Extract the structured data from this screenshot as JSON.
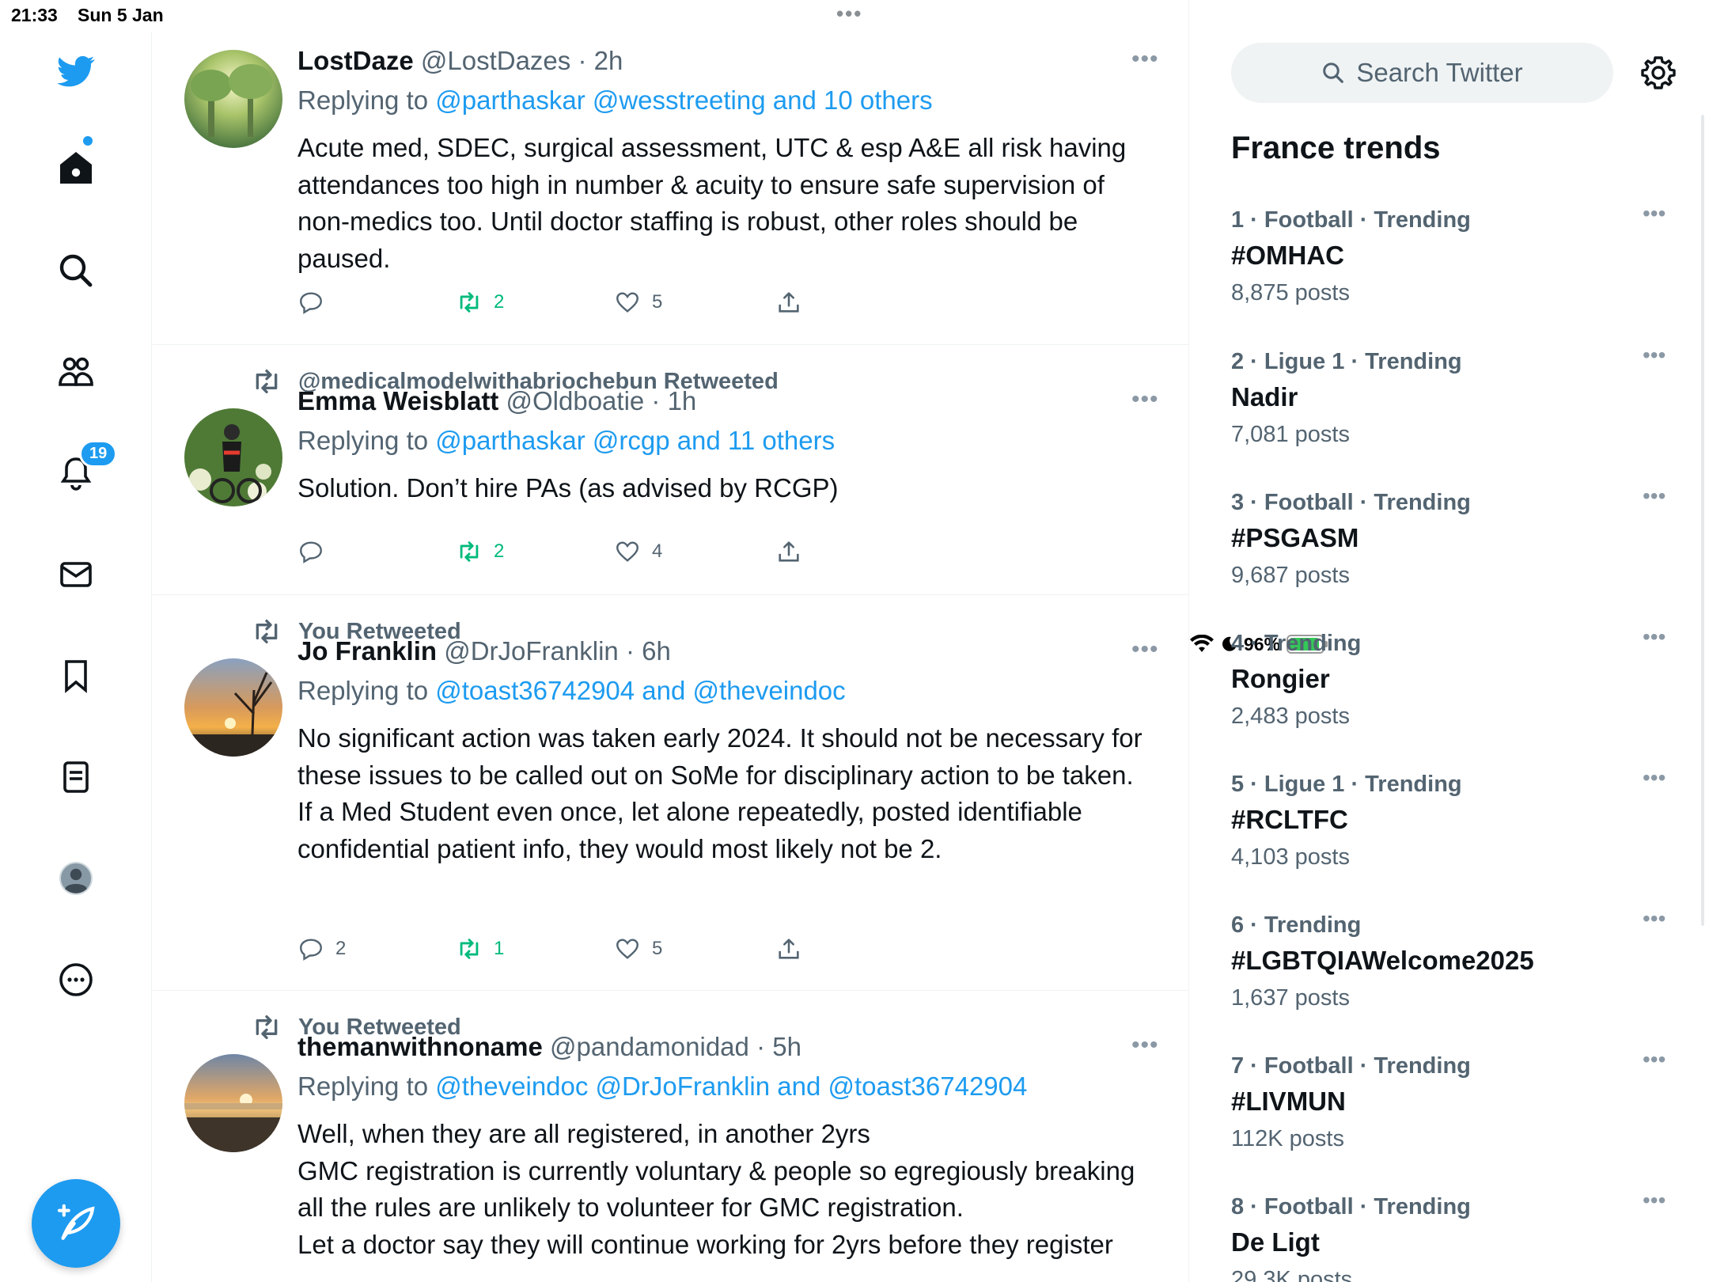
{
  "status_bar": {
    "time": "21:33",
    "date": "Sun 5 Jan",
    "battery": "96%"
  },
  "nav": {
    "notification_count": "19"
  },
  "tweets": [
    {
      "retweeted_by": "",
      "name": "LostDaze",
      "handle": "@LostDazes",
      "time": "· 2h",
      "reply_prefix": "Replying to ",
      "reply_mentions": "@parthaskar @wesstreeting and 10 others",
      "text": "Acute med, SDEC, surgical assessment, UTC & esp A&E all risk having attendances too high in number & acuity to ensure safe supervision of non-medics too. Until doctor staffing is robust, other roles should be paused.",
      "replies": "",
      "retweets": "2",
      "likes": "5"
    },
    {
      "retweeted_by": "@medicalmodelwithabriochebun Retweeted",
      "name": "Emma Weisblatt",
      "handle": "@Oldboatie",
      "time": "· 1h",
      "reply_prefix": "Replying to ",
      "reply_mentions": "@parthaskar @rcgp and 11 others",
      "text": "Solution. Don’t hire PAs (as advised by RCGP)",
      "replies": "",
      "retweets": "2",
      "likes": "4"
    },
    {
      "retweeted_by": "You Retweeted",
      "name": "Jo Franklin",
      "handle": "@DrJoFranklin",
      "time": "· 6h",
      "reply_prefix": "Replying to ",
      "reply_mentions": "@toast36742904 and @theveindoc",
      "text_lines": [
        "No significant action was taken early 2024. It should not be necessary for these issues to be called out on SoMe for disciplinary action to be taken.",
        "If a Med Student even once, let alone repeatedly, posted identifiable confidential patient info, they would most likely not be 2."
      ],
      "replies": "2",
      "retweets": "1",
      "likes": "5"
    },
    {
      "retweeted_by": "You Retweeted",
      "name": "themanwithnoname",
      "handle": "@pandamonidad",
      "time": "· 5h",
      "reply_prefix": "Replying to ",
      "reply_mentions": "@theveindoc @DrJoFranklin and @toast36742904",
      "text_lines": [
        "Well, when they are all registered, in another 2yrs",
        "GMC registration is currently voluntary & people so egregiously breaking all the rules are unlikely to volunteer for GMC registration.",
        "Let a doctor say they will continue working for 2yrs before they register"
      ]
    }
  ],
  "sidebar": {
    "search_placeholder": "Search Twitter",
    "trends_title": "France trends",
    "trends": [
      {
        "meta": "1 · Football · Trending",
        "name": "#OMHAC",
        "posts": "8,875 posts"
      },
      {
        "meta": "2 · Ligue 1 · Trending",
        "name": "Nadir",
        "posts": "7,081 posts"
      },
      {
        "meta": "3 · Football · Trending",
        "name": "#PSGASM",
        "posts": "9,687 posts"
      },
      {
        "meta": "4 · Trending",
        "name": "Rongier",
        "posts": "2,483 posts"
      },
      {
        "meta": "5 · Ligue 1 · Trending",
        "name": "#RCLTFC",
        "posts": "4,103 posts"
      },
      {
        "meta": "6 · Trending",
        "name": "#LGBTQIAWelcome2025",
        "posts": "1,637 posts"
      },
      {
        "meta": "7 · Football · Trending",
        "name": "#LIVMUN",
        "posts": "112K posts"
      },
      {
        "meta": "8 · Football · Trending",
        "name": "De Ligt",
        "posts": "29.3K posts"
      }
    ]
  },
  "colors": {
    "accent": "#1d9bf0",
    "retweet_green": "#00ba7c",
    "muted": "#536471"
  }
}
